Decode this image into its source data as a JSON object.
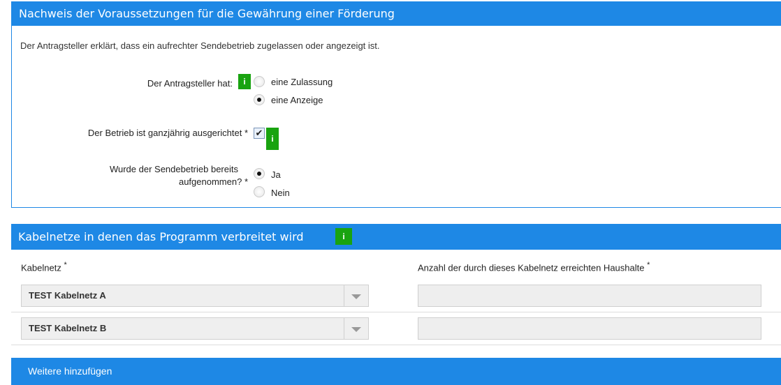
{
  "section1": {
    "title": "Nachweis der Voraussetzungen für die Gewährung einer Förderung",
    "intro": "Der Antragsteller erklärt, dass ein aufrechter Sendebetrieb zugelassen oder angezeigt ist.",
    "applicant_label": "Der Antragsteller hat:",
    "applicant_options": [
      "eine Zulassung",
      "eine Anzeige"
    ],
    "applicant_selected": "eine Anzeige",
    "yearround_label": "Der Betrieb ist ganzjährig ausgerichtet",
    "yearround_checked": true,
    "started_label_line1": "Wurde der Sendebetrieb bereits",
    "started_label_line2": "aufgenommen?",
    "started_options": [
      "Ja",
      "Nein"
    ],
    "started_selected": "Ja",
    "required_mark": "*",
    "info_glyph": "i"
  },
  "section2": {
    "title": "Kabelnetze in denen das Programm verbreitet wird",
    "col_network": "Kabelnetz",
    "col_households": "Anzahl der durch dieses Kabelnetz erreichten Haushalte",
    "rows": [
      {
        "network": "TEST Kabelnetz A",
        "households": ""
      },
      {
        "network": "TEST Kabelnetz B",
        "households": ""
      }
    ],
    "add_button": "Weitere hinzufügen"
  },
  "colors": {
    "header_blue": "#1e88e5",
    "info_green": "#19a310"
  },
  "icons": {
    "info": "info-icon",
    "dropdown": "chevron-down-icon",
    "check": "checkmark-icon"
  }
}
